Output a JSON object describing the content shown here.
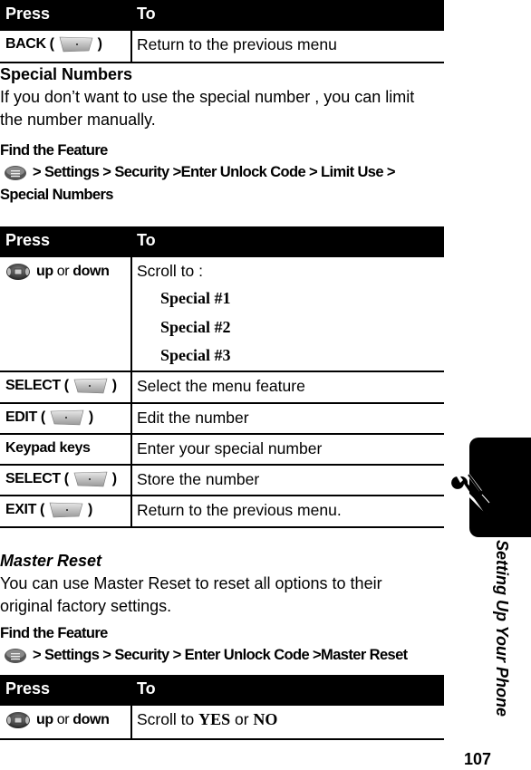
{
  "table_top": {
    "header": {
      "press": "Press",
      "to": "To"
    },
    "rows": [
      {
        "key_label": "BACK (",
        "key_icon": "right-softkey-icon",
        "key_suffix": ")",
        "action": "Return to the previous menu"
      }
    ]
  },
  "special_numbers": {
    "heading": "Special Numbers",
    "description": "If you don’t want to use the special number , you can limit the number manually.",
    "find_feature_label": "Find the Feature",
    "path_line1": "> Settings > Security >Enter Unlock Code > Limit Use >",
    "path_line2": "Special Numbers",
    "table": {
      "header": {
        "press": "Press",
        "to": "To"
      },
      "scroll_row": {
        "key_up": "up",
        "key_or": "or",
        "key_down": "down",
        "action": "Scroll to :",
        "options": [
          "Special #1",
          "Special #2",
          "Special #3"
        ]
      },
      "rows": [
        {
          "key_label": "SELECT (",
          "key_suffix": ")",
          "action": "Select the menu feature"
        },
        {
          "key_label": "EDIT (",
          "key_suffix": ")",
          "action": "Edit the number"
        },
        {
          "key_label": "Keypad keys",
          "key_suffix": "",
          "action": "Enter your special number"
        },
        {
          "key_label": "SELECT (",
          "key_suffix": ")",
          "action": "Store the number"
        },
        {
          "key_label": "EXIT (",
          "key_suffix": ")",
          "action": "Return to the previous menu."
        }
      ]
    }
  },
  "master_reset": {
    "heading": "Master Reset",
    "description": "You can use Master Reset to reset all options to their original factory settings.",
    "find_feature_label": "Find the Feature",
    "path_line1": "> Settings > Security > Enter Unlock Code >Master Reset",
    "table": {
      "header": {
        "press": "Press",
        "to": "To"
      },
      "scroll_row": {
        "key_up": "up",
        "key_or": "or",
        "key_down": "down",
        "action_prefix": "Scroll to",
        "opt_yes": "YES",
        "action_or": "or",
        "opt_no": "NO"
      }
    }
  },
  "side_tab": {
    "label": "Setting Up Your Phone",
    "icon": "wrench-screwdriver-icon"
  },
  "page_number": "107"
}
